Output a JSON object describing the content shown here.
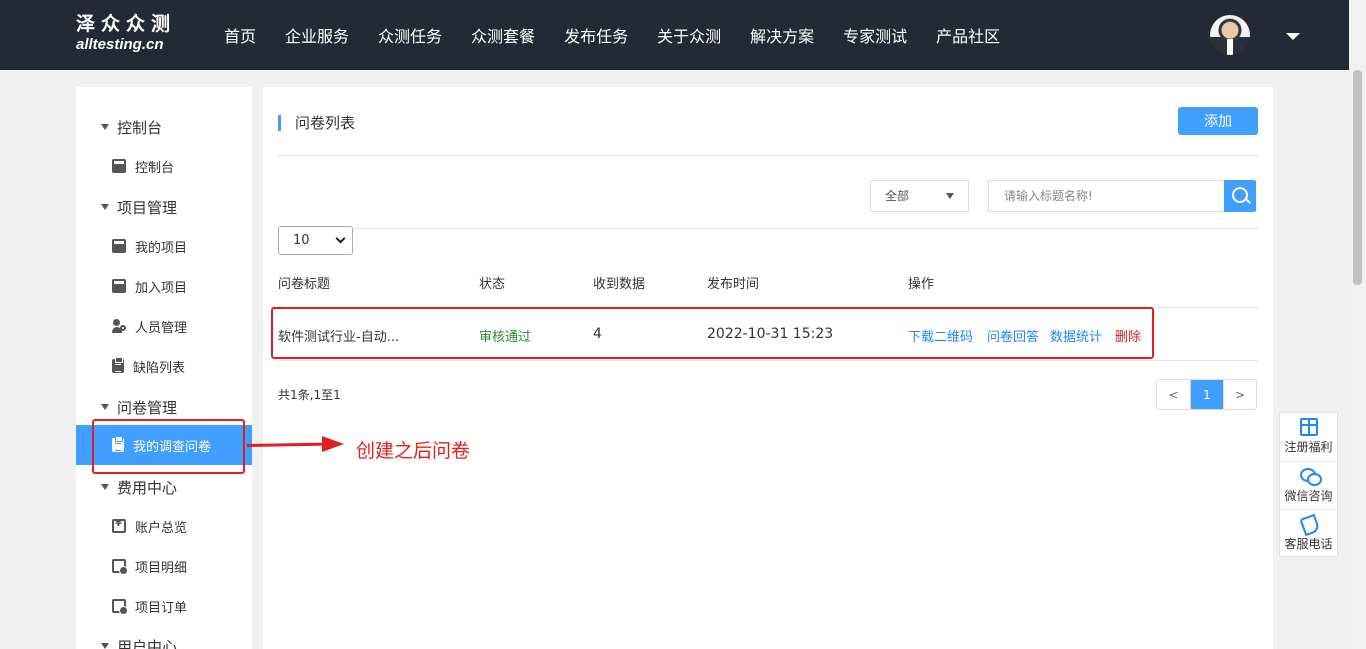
{
  "header": {
    "logo_cn": "泽众众测",
    "logo_en": "alltesting.cn",
    "nav": [
      "首页",
      "企业服务",
      "众测任务",
      "众测套餐",
      "发布任务",
      "关于众测",
      "解决方案",
      "专家测试",
      "产品社区"
    ]
  },
  "sidebar": {
    "groups": [
      {
        "label": "控制台",
        "items": [
          {
            "label": "控制台",
            "icon": "book-icon"
          }
        ]
      },
      {
        "label": "项目管理",
        "items": [
          {
            "label": "我的项目",
            "icon": "book-icon"
          },
          {
            "label": "加入项目",
            "icon": "book-icon"
          },
          {
            "label": "人员管理",
            "icon": "users-icon"
          },
          {
            "label": "缺陷列表",
            "icon": "clipboard-icon"
          }
        ]
      },
      {
        "label": "问卷管理",
        "items": [
          {
            "label": "我的调查问卷",
            "icon": "clipboard-icon",
            "active": true
          }
        ]
      },
      {
        "label": "费用中心",
        "items": [
          {
            "label": "账户总览",
            "icon": "money-icon"
          },
          {
            "label": "项目明细",
            "icon": "detail-icon"
          },
          {
            "label": "项目订单",
            "icon": "detail-icon"
          }
        ]
      },
      {
        "label": "用户中心",
        "items": []
      }
    ]
  },
  "main": {
    "title": "问卷列表",
    "add_button": "添加",
    "filter_value": "全部",
    "search_placeholder": "请输入标题名称!",
    "page_size": "10",
    "columns": [
      "问卷标题",
      "状态",
      "收到数据",
      "发布时间",
      "操作"
    ],
    "rows": [
      {
        "title": "软件测试行业-自动...",
        "status": "审核通过",
        "count": "4",
        "time": "2022-10-31 15:23",
        "actions": [
          "下载二维码",
          "问卷回答",
          "数据统计",
          "删除"
        ]
      }
    ],
    "summary": "共1条,1至1",
    "pager": {
      "prev": "<",
      "current": "1",
      "next": ">"
    }
  },
  "annotation": {
    "text": "创建之后问卷"
  },
  "float_tools": [
    "注册福利",
    "微信咨询",
    "客服电话"
  ],
  "colors": {
    "primary": "#409eff",
    "header_bg": "#232a35",
    "highlight": "#e02020",
    "success": "#2e8b2e"
  }
}
